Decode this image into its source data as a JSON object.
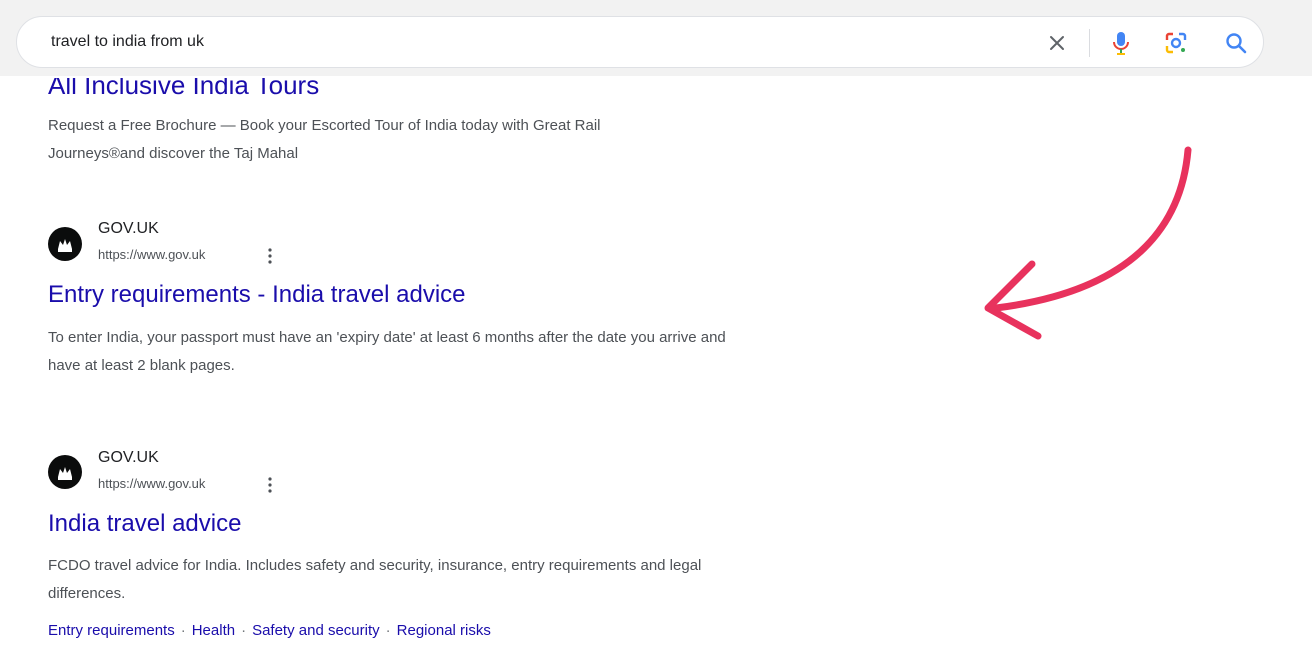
{
  "search": {
    "query": "travel to india from uk",
    "icons": [
      "close-icon",
      "microphone-icon",
      "lens-icon",
      "search-icon"
    ]
  },
  "ad": {
    "title": "All Inclusive India Tours",
    "snippet_line1": "Request a Free Brochure — Book your Escorted Tour of India today with Great Rail",
    "snippet_line2": "Journeys®and discover the Taj Mahal"
  },
  "results": [
    {
      "site_name": "GOV.UK",
      "url": "https://www.gov.uk",
      "title": "Entry requirements - India travel advice",
      "snippet_line1": "To enter India, your passport must have an 'expiry date' at least 6 months after the date you arrive and",
      "snippet_line2": "have at least 2 blank pages."
    },
    {
      "site_name": "GOV.UK",
      "url": "https://www.gov.uk",
      "title": "India travel advice",
      "snippet_line1": "FCDO travel advice for India. Includes safety and security, insurance, entry requirements and legal",
      "snippet_line2": "differences.",
      "sitelinks": [
        "Entry requirements",
        "Health",
        "Safety and security",
        "Regional risks"
      ]
    }
  ],
  "colors": {
    "link": "#1a0dab",
    "annotation_arrow": "#e8325d",
    "topbar": "#f2f2f2"
  }
}
